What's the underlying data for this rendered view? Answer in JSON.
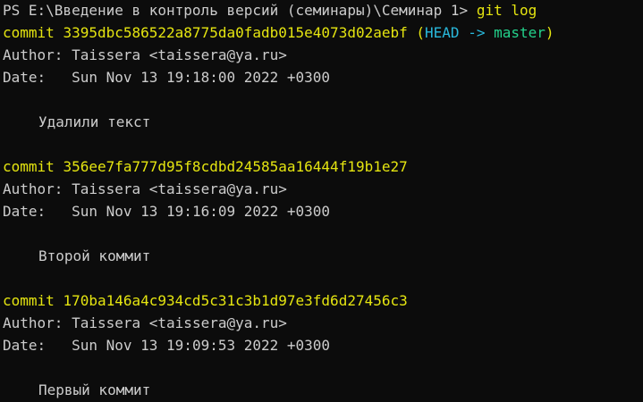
{
  "colors": {
    "background": "#0c0c0c",
    "text": "#cccccc",
    "commit": "#e5e510",
    "head": "#29b8db",
    "branch": "#23d18b"
  },
  "prompt": {
    "path": "PS E:\\Введение в контроль версий (семинары)\\Семинар 1> ",
    "command": "git log"
  },
  "commits": [
    {
      "label": "commit",
      "hash": "3395dbc586522a8775da0fadb015e4073d02aebf",
      "ref_open": "(",
      "ref_head": "HEAD -> ",
      "ref_branch": "master",
      "ref_close": ")",
      "author_label": "Author:",
      "author": "Taissera <taissera@ya.ru>",
      "date_label": "Date:",
      "date": "Sun Nov 13 19:18:00 2022 +0300",
      "message": "Удалили текст"
    },
    {
      "label": "commit",
      "hash": "356ee7fa777d95f8cdbd24585aa16444f19b1e27",
      "author_label": "Author:",
      "author": "Taissera <taissera@ya.ru>",
      "date_label": "Date:",
      "date": "Sun Nov 13 19:16:09 2022 +0300",
      "message": "Второй коммит"
    },
    {
      "label": "commit",
      "hash": "170ba146a4c934cd5c31c3b1d97e3fd6d27456c3",
      "author_label": "Author:",
      "author": "Taissera <taissera@ya.ru>",
      "date_label": "Date:",
      "date": "Sun Nov 13 19:09:53 2022 +0300",
      "message": "Первый коммит"
    }
  ]
}
